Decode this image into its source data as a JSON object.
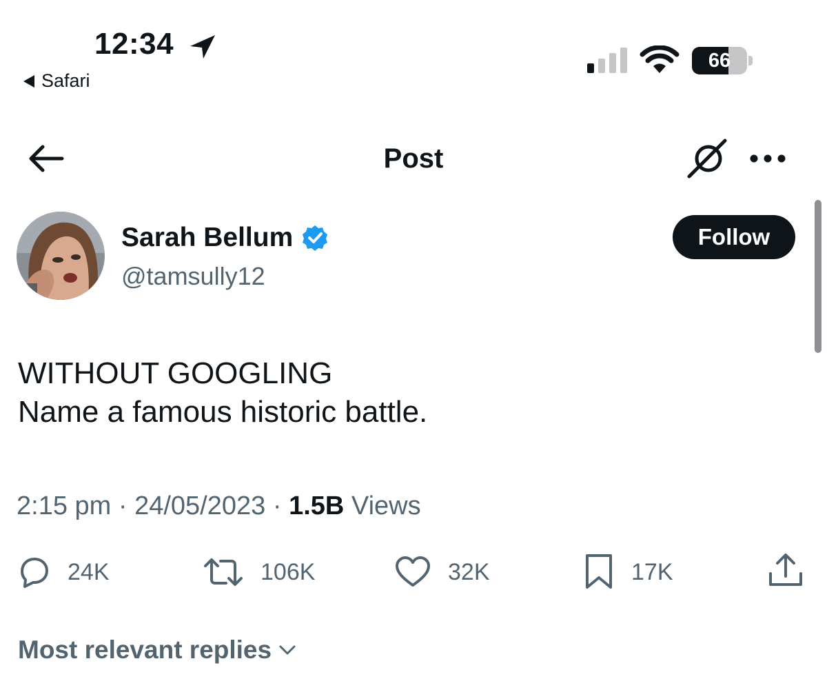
{
  "status_bar": {
    "time": "12:34",
    "back_app": "Safari",
    "battery_percent": "66",
    "battery_level": 0.66,
    "signal_bars": 1,
    "icons": [
      "location-arrow-icon",
      "cellular-signal-icon",
      "wifi-icon",
      "battery-icon"
    ]
  },
  "header": {
    "title": "Post",
    "icons": [
      "back-arrow-icon",
      "grok-icon",
      "more-icon"
    ]
  },
  "author": {
    "display_name": "Sarah Bellum",
    "handle": "@tamsully12",
    "verified": true,
    "follow_label": "Follow"
  },
  "tweet": {
    "lines": [
      "WITHOUT GOOGLING",
      "Name a famous historic battle."
    ],
    "time": "2:15 pm",
    "date": "24/05/2023",
    "separator": "·",
    "views_count": "1.5B",
    "views_label": "Views"
  },
  "actions": {
    "replies": "24K",
    "reposts": "106K",
    "likes": "32K",
    "bookmarks": "17K",
    "icons": [
      "reply-icon",
      "repost-icon",
      "like-icon",
      "bookmark-icon",
      "share-icon"
    ]
  },
  "replies_sort": {
    "label": "Most relevant replies"
  },
  "colors": {
    "text": "#0f1419",
    "secondary": "#536471",
    "verified": "#1d9bf0",
    "follow_bg": "#0f1419"
  }
}
